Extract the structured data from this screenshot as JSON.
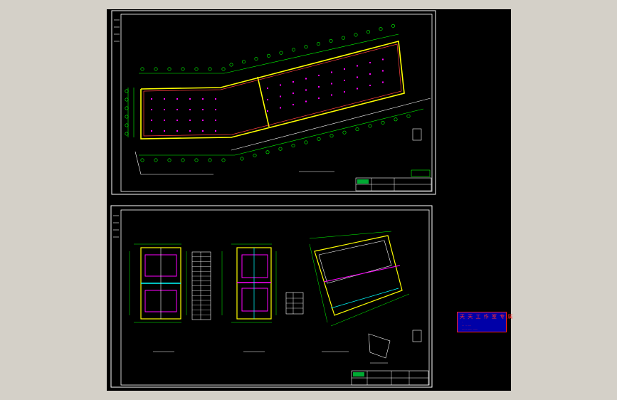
{
  "viewer": {
    "background": "#d4d0c8",
    "canvas_color": "#000000"
  },
  "sheets": [
    {
      "name": "sheet-top",
      "content": "site-plan"
    },
    {
      "name": "sheet-bottom",
      "content": "floor-plans"
    }
  ],
  "stamp": {
    "title": "天 天 工 作 室 专 属",
    "line1": "·",
    "line2": "··· ·· ·····",
    "line3": "······ ······ ······",
    "fill": "#0000a8",
    "text_color": "#ff3030"
  },
  "colors": {
    "frame": "#ffffff",
    "grid": "#00ff00",
    "wall": "#ffff00",
    "column": "#ff00ff",
    "dim": "#00ffff",
    "table": "#00ff00"
  }
}
